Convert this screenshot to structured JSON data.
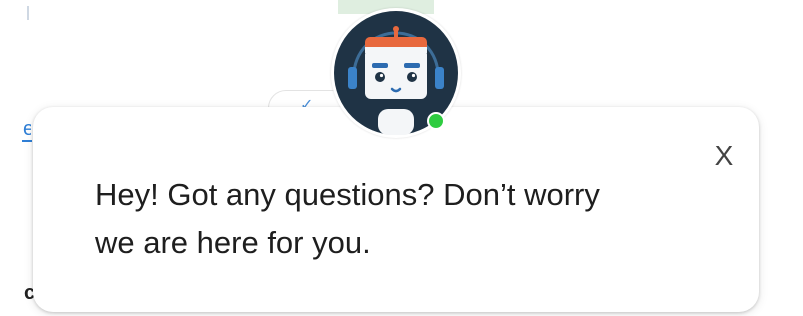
{
  "popup": {
    "message_line1": "Hey! Got any questions? Don’t worry",
    "message_line2": "we are here for you.",
    "close_label": "X"
  },
  "avatar": {
    "icon": "chatbot-robot-icon",
    "status": "online",
    "status_color": "#2ecc40",
    "ring_color": "#1f3345"
  },
  "background": {
    "link_fragment": "e",
    "bottom_glyph": "c"
  }
}
